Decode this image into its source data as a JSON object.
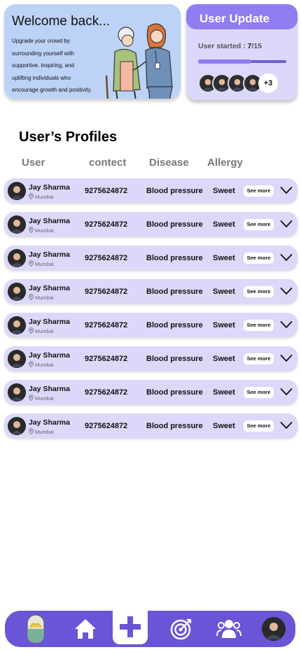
{
  "welcome": {
    "title": "Welcome back...",
    "lines": [
      "Upgrade your crowd by",
      "surrounding yourself with",
      "supportive, inspiring, and",
      "uplifting individuals who",
      "encourage growth and positivity."
    ]
  },
  "update": {
    "title": "User Update",
    "status_label": "User started :",
    "started": "7",
    "total": "/15",
    "progress": 0.6,
    "more": "+3"
  },
  "profiles": {
    "title": "User’s Profiles",
    "columns": [
      "User",
      "contect",
      "Disease",
      "Allergy"
    ],
    "see_more": "See more",
    "rows": [
      {
        "name": "Jay Sharma",
        "location": "Mumbai",
        "contact": "9275624872",
        "disease": "Blood pressure",
        "allergy": "Sweet"
      },
      {
        "name": "Jay Sharma",
        "location": "Mumbai",
        "contact": "9275624872",
        "disease": "Blood pressure",
        "allergy": "Sweet"
      },
      {
        "name": "Jay Sharma",
        "location": "Mumbai",
        "contact": "9275624872",
        "disease": "Blood pressure",
        "allergy": "Sweet"
      },
      {
        "name": "Jay Sharma",
        "location": "Mumbai",
        "contact": "9275624872",
        "disease": "Blood pressure",
        "allergy": "Sweet"
      },
      {
        "name": "Jay Sharma",
        "location": "Mumbai",
        "contact": "9275624872",
        "disease": "Blood pressure",
        "allergy": "Sweet"
      },
      {
        "name": "Jay Sharma",
        "location": "Mumbai",
        "contact": "9275624872",
        "disease": "Blood pressure",
        "allergy": "Sweet"
      },
      {
        "name": "Jay Sharma",
        "location": "Mumbai",
        "contact": "9275624872",
        "disease": "Blood pressure",
        "allergy": "Sweet"
      },
      {
        "name": "Jay Sharma",
        "location": "Mumbai",
        "contact": "9275624872",
        "disease": "Blood pressure",
        "allergy": "Sweet"
      }
    ]
  },
  "nav": {
    "items": [
      "pill-icon",
      "home-icon",
      "plus-icon",
      "target-icon",
      "users-icon",
      "profile-avatar"
    ]
  },
  "colors": {
    "accent": "#6a55d6",
    "accent_light": "#8e7ef0",
    "row_bg": "#dcd8fa",
    "welcome_bg": "#bcd2f7"
  }
}
